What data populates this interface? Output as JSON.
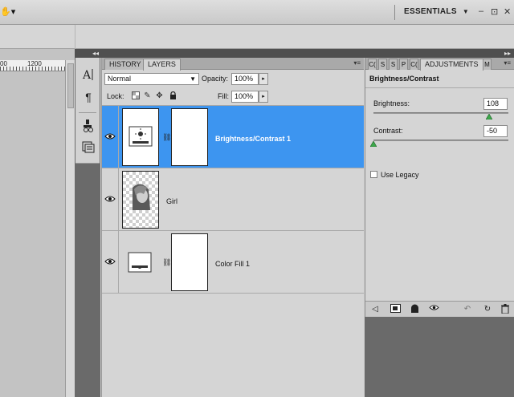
{
  "app_bar": {
    "workspace_label": "ESSENTIALS",
    "workspace_caret": "▼",
    "window_controls": [
      "–",
      "⊡",
      "✕"
    ]
  },
  "ruler": {
    "labels": [
      "00",
      "1200"
    ]
  },
  "dock": {
    "collapse_arrows": [
      "◂◂",
      "▸▸"
    ],
    "icons": [
      "character-icon",
      "paragraph-icon",
      "clone-source-icon",
      "tool-presets-icon"
    ]
  },
  "layers_panel": {
    "tabs": [
      "HISTORY",
      "LAYERS"
    ],
    "active_tab": "LAYERS",
    "blend_mode": "Normal",
    "opacity_label": "Opacity:",
    "opacity_value": "100%",
    "lock_label": "Lock:",
    "fill_label": "Fill:",
    "fill_value": "100%",
    "layers": [
      {
        "name": "Brightness/Contrast 1",
        "selected": true,
        "type": "adjustment"
      },
      {
        "name": "Girl",
        "selected": false,
        "type": "image"
      },
      {
        "name": "Color Fill 1",
        "selected": false,
        "type": "fill"
      }
    ]
  },
  "adjustments_panel": {
    "mini_tabs": [
      "C(",
      "S",
      "S",
      "P",
      "C("
    ],
    "tab": "ADJUSTMENTS",
    "trailing_tab": "M",
    "title": "Brightness/Contrast",
    "brightness_label": "Brightness:",
    "brightness_value": "108",
    "brightness_level": 0.86,
    "contrast_label": "Contrast:",
    "contrast_value": "-50",
    "contrast_level": 0.0,
    "legacy_label": "Use Legacy",
    "legacy_checked": false
  },
  "colors": {
    "selection": "#3d95f0",
    "panel_bg": "#d5d5d5",
    "dark_bg": "#6a6a6a",
    "slider_handle": "#3ca84a"
  }
}
